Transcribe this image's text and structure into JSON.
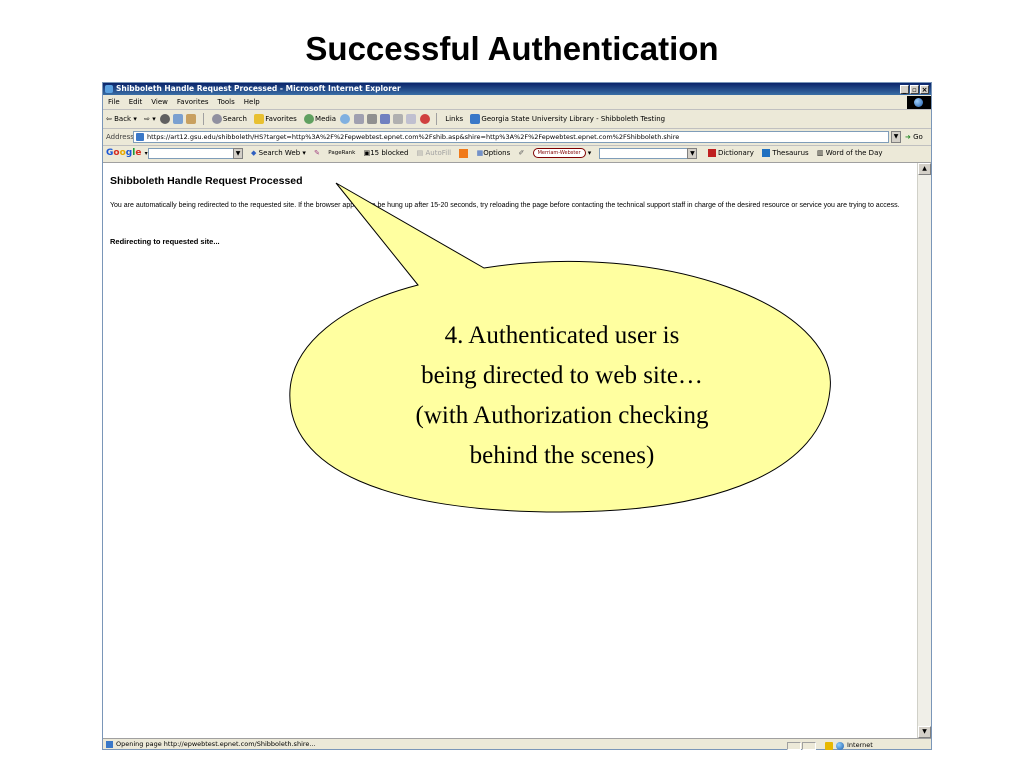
{
  "slide": {
    "title": "Successful Authentication"
  },
  "window": {
    "title": "Shibboleth Handle Request Processed - Microsoft Internet Explorer",
    "controls": [
      "_",
      "̈",
      "×"
    ]
  },
  "menu": [
    "File",
    "Edit",
    "View",
    "Favorites",
    "Tools",
    "Help"
  ],
  "toolbar": {
    "back": "Back",
    "search": "Search",
    "favorites": "Favorites",
    "media": "Media",
    "links": "Links",
    "link_item": "Georgia State University Library - Shibboleth Testing"
  },
  "address": {
    "label": "Address",
    "url": "https://art12.gsu.edu/shibboleth/HS?target=http%3A%2F%2Fepwebtest.epnet.com%2Fshib.asp&shire=http%3A%2F%2Fepwebtest.epnet.com%2FShibboleth.shire",
    "go": "Go"
  },
  "google_bar": {
    "search_web": "Search Web",
    "pagerank": "PageRank",
    "blocked": "15 blocked",
    "autofill": "AutoFill",
    "options": "Options",
    "mw_badge": "Merriam-Webster",
    "dictionary": "Dictionary",
    "thesaurus": "Thesaurus",
    "word_of_day": "Word of the Day"
  },
  "page": {
    "heading": "Shibboleth Handle Request Processed",
    "paragraph": "You are automatically being redirected to the requested site. If the browser appears to be hung up after 15-20 seconds, try reloading the page before contacting the technical support staff in charge of the desired resource or service you are trying to access.",
    "redirect": "Redirecting to requested site..."
  },
  "status": {
    "text": "Opening page http://epwebtest.epnet.com/Shibboleth.shire...",
    "zone": "Internet"
  },
  "callout": {
    "lines": [
      "4. Authenticated user is",
      "being directed to web site…",
      "(with Authorization checking",
      "behind the scenes)"
    ],
    "fill": "#ffffa0"
  }
}
